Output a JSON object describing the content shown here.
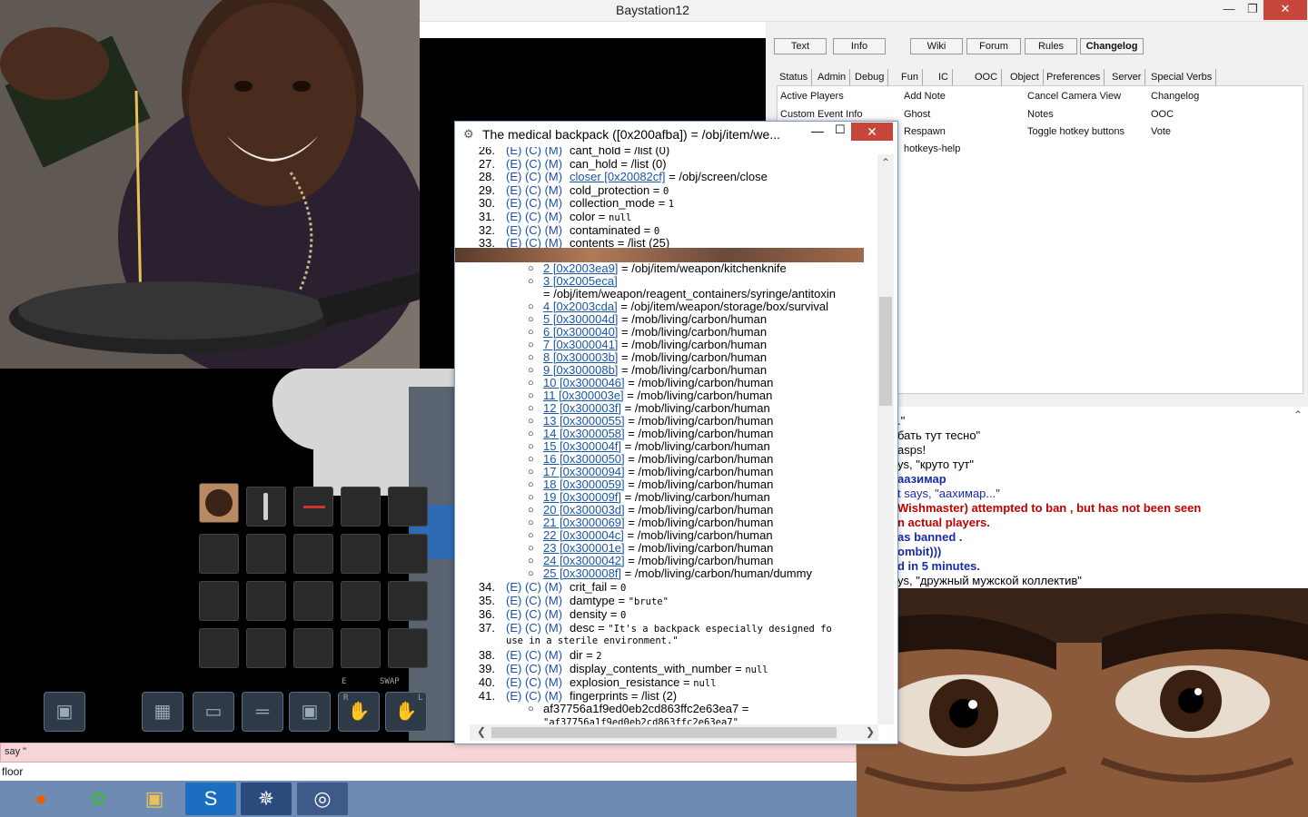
{
  "window": {
    "title": "Baystation12",
    "minimize": "—",
    "restore": "❐",
    "close": "✕"
  },
  "top_tabs": [
    {
      "label": "Text"
    },
    {
      "label": "Info"
    },
    {
      "label": "Wiki"
    },
    {
      "label": "Forum"
    },
    {
      "label": "Rules"
    },
    {
      "label": "Changelog",
      "active": true
    }
  ],
  "verb_tabs": [
    "Status",
    "Admin",
    "Debug",
    "Fun",
    "IC",
    "OOC",
    "Object",
    "Preferences",
    "Server",
    "Special Verbs"
  ],
  "verbs": [
    [
      "Active Players",
      "Add Note",
      "Cancel Camera View",
      "Changelog"
    ],
    [
      "Custom Event Info",
      "Ghost",
      "Notes",
      "OOC"
    ],
    [
      "",
      "Respawn",
      "Toggle hotkey buttons",
      "Vote"
    ],
    [
      "",
      "hotkeys-help",
      "",
      ""
    ]
  ],
  "chat_lines": [
    {
      "text": ".\"",
      "color": "#000",
      "bold": false
    },
    {
      "text": "бать тут тесно\"",
      "color": "#000",
      "bold": false
    },
    {
      "text": "asps!",
      "color": "#000",
      "bold": false
    },
    {
      "text": "ys, \"круто тут\"",
      "color": "#000",
      "bold": false
    },
    {
      "text": "аазимар",
      "color": "#1b2aa8",
      "bold": true
    },
    {
      "text": "t says, \"аахимар...\"",
      "color": "#1b2aa8",
      "bold": false
    },
    {
      "text": "Wishmaster) attempted to ban , but  has not been seen",
      "color": "#c00000",
      "bold": true
    },
    {
      "text": "n actual players.",
      "color": "#c00000",
      "bold": true
    },
    {
      "text": "as banned .",
      "color": "#1b2aa8",
      "bold": true
    },
    {
      "text": "ombit)))",
      "color": "#1b2aa8",
      "bold": true
    },
    {
      "text": "d in 5 minutes.",
      "color": "#1b2aa8",
      "bold": true
    },
    {
      "text": "ys, \"дружный мужской коллектив\"",
      "color": "#000",
      "bold": false
    }
  ],
  "input": {
    "value": "say \""
  },
  "status": {
    "text": "floor"
  },
  "hud": {
    "swap_label": "SWAP",
    "e_label": "E",
    "r_label": "R",
    "l_label": "L"
  },
  "taskbar": [
    {
      "name": "firefox",
      "glyph": "●",
      "color": "#e66000"
    },
    {
      "name": "icq",
      "glyph": "✿",
      "color": "#4caf50"
    },
    {
      "name": "explorer",
      "glyph": "▣",
      "color": "#e8c15a"
    },
    {
      "name": "skype",
      "glyph": "S",
      "color": "#ffffff"
    },
    {
      "name": "byond",
      "glyph": "✵",
      "color": "#ffffff"
    },
    {
      "name": "ss13",
      "glyph": "◎",
      "color": "#ffffff"
    }
  ],
  "vv": {
    "title": "The medical backpack ([0x200afba]) = /obj/item/we...",
    "rows": [
      {
        "n": "26.",
        "e": "(E) (C) (M)",
        "name": "cant_hold",
        "eq": " = ",
        "val": "/list (0)",
        "mono": false
      },
      {
        "n": "27.",
        "e": "(E) (C) (M)",
        "name": "can_hold",
        "eq": " = ",
        "val": "/list (0)",
        "mono": false
      },
      {
        "n": "28.",
        "e": "(E) (C) (M)",
        "name": "closer [0x20082cf]",
        "eq": " = ",
        "val": "/obj/screen/close",
        "mono": false,
        "link": true
      },
      {
        "n": "29.",
        "e": "(E) (C) (M)",
        "name": "cold_protection",
        "eq": " = ",
        "val": "0",
        "mono": true
      },
      {
        "n": "30.",
        "e": "(E) (C) (M)",
        "name": "collection_mode",
        "eq": " = ",
        "val": "1",
        "mono": true
      },
      {
        "n": "31.",
        "e": "(E) (C) (M)",
        "name": "color",
        "eq": " = ",
        "val": "null",
        "mono": true
      },
      {
        "n": "32.",
        "e": "(E) (C) (M)",
        "name": "contaminated",
        "eq": " = ",
        "val": "0",
        "mono": true
      },
      {
        "n": "33.",
        "e": "(E) (C) (M)",
        "name": "contents",
        "eq": " = ",
        "val": "/list (25)",
        "mono": false
      }
    ],
    "contents": [
      {
        "link": "2 [0x2003ea9]",
        "val": "= /obj/item/weapon/kitchenknife"
      },
      {
        "link": "3 [0x2005eca]",
        "val": ""
      },
      {
        "link": "",
        "val": "= /obj/item/weapon/reagent_containers/syringe/antitoxin"
      },
      {
        "link": "4 [0x2003cda]",
        "val": "= /obj/item/weapon/storage/box/survival"
      },
      {
        "link": "5 [0x300004d]",
        "val": "= /mob/living/carbon/human"
      },
      {
        "link": "6 [0x3000040]",
        "val": "= /mob/living/carbon/human"
      },
      {
        "link": "7 [0x3000041]",
        "val": "= /mob/living/carbon/human"
      },
      {
        "link": "8 [0x300003b]",
        "val": "= /mob/living/carbon/human"
      },
      {
        "link": "9 [0x300008b]",
        "val": "= /mob/living/carbon/human"
      },
      {
        "link": "10 [0x3000046]",
        "val": "= /mob/living/carbon/human"
      },
      {
        "link": "11 [0x300003e]",
        "val": "= /mob/living/carbon/human"
      },
      {
        "link": "12 [0x300003f]",
        "val": "= /mob/living/carbon/human"
      },
      {
        "link": "13 [0x3000055]",
        "val": "= /mob/living/carbon/human"
      },
      {
        "link": "14 [0x3000058]",
        "val": "= /mob/living/carbon/human"
      },
      {
        "link": "15 [0x300004f]",
        "val": "= /mob/living/carbon/human"
      },
      {
        "link": "16 [0x3000050]",
        "val": "= /mob/living/carbon/human"
      },
      {
        "link": "17 [0x3000094]",
        "val": "= /mob/living/carbon/human"
      },
      {
        "link": "18 [0x3000059]",
        "val": "= /mob/living/carbon/human"
      },
      {
        "link": "19 [0x300009f]",
        "val": "= /mob/living/carbon/human"
      },
      {
        "link": "20 [0x300003d]",
        "val": "= /mob/living/carbon/human"
      },
      {
        "link": "21 [0x3000069]",
        "val": "= /mob/living/carbon/human"
      },
      {
        "link": "22 [0x300004c]",
        "val": "= /mob/living/carbon/human"
      },
      {
        "link": "23 [0x300001e]",
        "val": "= /mob/living/carbon/human"
      },
      {
        "link": "24 [0x3000042]",
        "val": "= /mob/living/carbon/human"
      },
      {
        "link": "25 [0x300008f]",
        "val": "= /mob/living/carbon/human/dummy"
      }
    ],
    "rows2": [
      {
        "n": "34.",
        "e": "(E) (C) (M)",
        "name": "crit_fail",
        "eq": " = ",
        "val": "0",
        "mono": true
      },
      {
        "n": "35.",
        "e": "(E) (C) (M)",
        "name": "damtype",
        "eq": " = ",
        "val": "\"brute\"",
        "mono": true
      },
      {
        "n": "36.",
        "e": "(E) (C) (M)",
        "name": "density",
        "eq": " = ",
        "val": "0",
        "mono": true
      },
      {
        "n": "37.",
        "e": "(E) (C) (M)",
        "name": "desc",
        "eq": " = ",
        "val": "\"It's a backpack especially designed fo",
        "mono": true
      }
    ],
    "desc_cont": "use in a sterile environment.\"",
    "rows3": [
      {
        "n": "38.",
        "e": "(E) (C) (M)",
        "name": "dir",
        "eq": " = ",
        "val": "2",
        "mono": true
      },
      {
        "n": "39.",
        "e": "(E) (C) (M)",
        "name": "display_contents_with_number",
        "eq": " = ",
        "val": "null",
        "mono": true
      },
      {
        "n": "40.",
        "e": "(E) (C) (M)",
        "name": "explosion_resistance",
        "eq": " = ",
        "val": "null",
        "mono": true
      },
      {
        "n": "41.",
        "e": "(E) (C) (M)",
        "name": "fingerprints",
        "eq": " = ",
        "val": "/list (2)",
        "mono": false
      }
    ],
    "fingerprint": "af37756a1f9ed0eb2cd863ffc2e63ea7 =",
    "fingerprint2": "\"af37756a1f9ed0eb2cd863ffc2e63ea7\""
  }
}
